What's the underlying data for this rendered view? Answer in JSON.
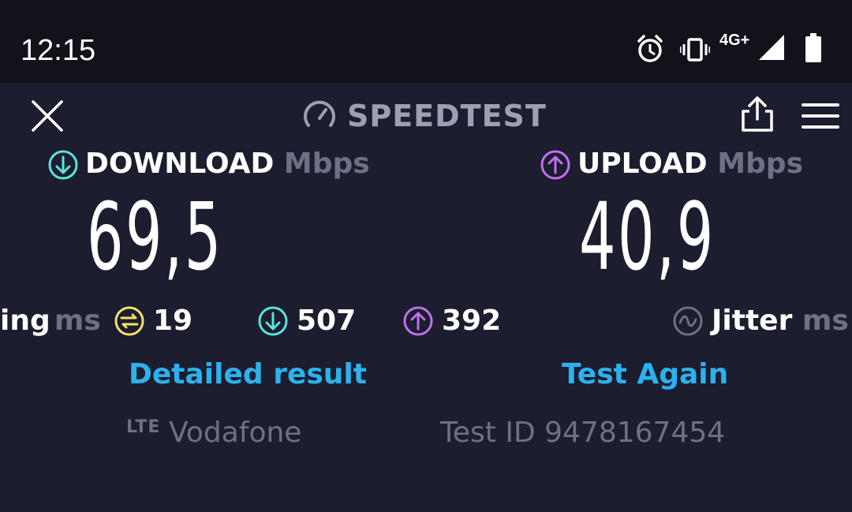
{
  "status_bar": {
    "time": "12:15",
    "network_type": "4G+",
    "icons": [
      "alarm-icon",
      "vibrate-icon",
      "signal-icon",
      "battery-icon"
    ]
  },
  "header": {
    "title": "SPEEDTEST",
    "icons": [
      "close-icon",
      "gauge-icon",
      "share-icon",
      "menu-icon"
    ]
  },
  "download": {
    "label": "DOWNLOAD",
    "unit": "Mbps",
    "value": "69,5",
    "color": "#5ce3dc"
  },
  "upload": {
    "label": "UPLOAD",
    "unit": "Mbps",
    "value": "40,9",
    "color": "#c36ef0"
  },
  "stats": {
    "ping_label": "ing",
    "ping_unit": "ms",
    "ping_value": "19",
    "ping_color": "#f4e16e",
    "download_latency": "507",
    "upload_latency": "392",
    "jitter_label": "Jitter",
    "jitter_unit": "ms"
  },
  "links": {
    "detailed_result": "Detailed result",
    "test_again": "Test Again",
    "link_color": "#2bb2ee"
  },
  "footer": {
    "network_badge": "LTE",
    "provider": "Vodafone",
    "test_id": "Test ID 9478167454"
  }
}
